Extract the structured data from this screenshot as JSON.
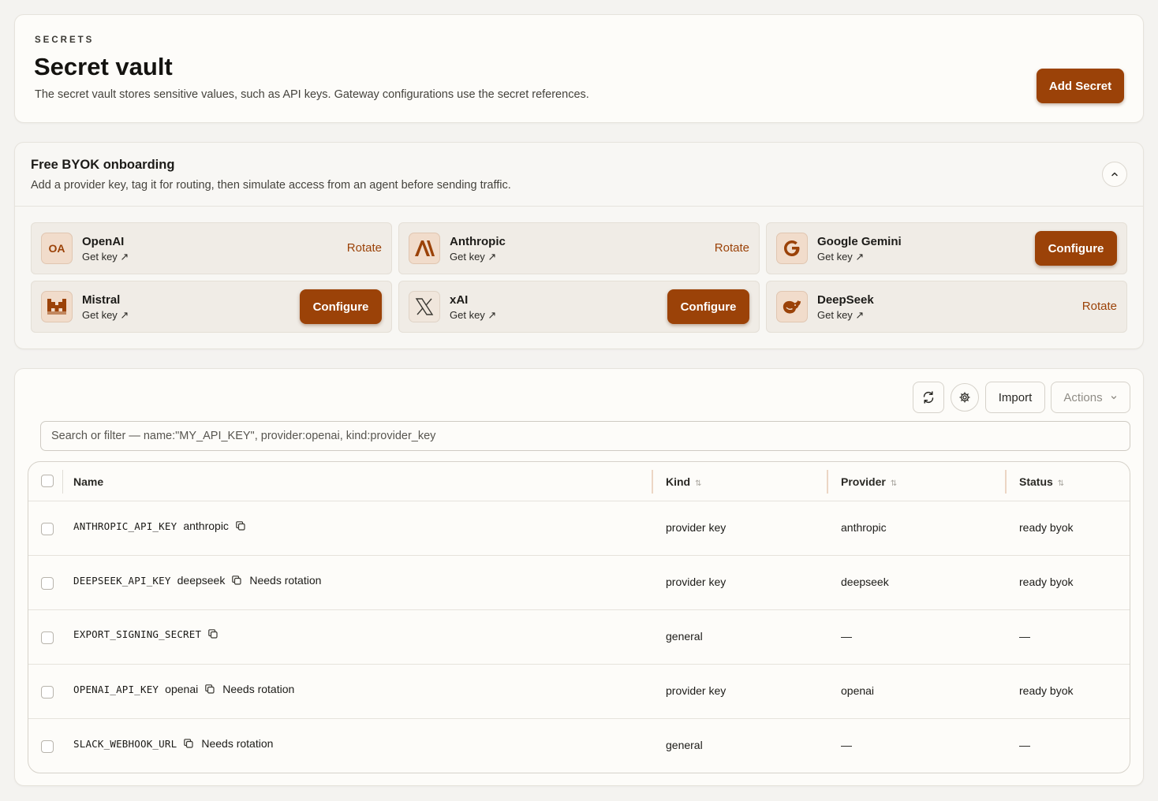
{
  "header": {
    "eyebrow": "SECRETS",
    "title": "Secret vault",
    "description": "The secret vault stores sensitive values, such as API keys. Gateway configurations use the secret references.",
    "add_button": "Add Secret"
  },
  "onboarding": {
    "title": "Free BYOK onboarding",
    "description": "Add a provider key, tag it for routing, then simulate access from an agent before sending traffic.",
    "get_key_label": "Get key ↗",
    "providers": [
      {
        "name": "OpenAI",
        "logo": "OA",
        "icon": "openai-logo",
        "action": "Rotate"
      },
      {
        "name": "Anthropic",
        "logo": "A\\",
        "icon": "anthropic-logo",
        "action": "Rotate"
      },
      {
        "name": "Google Gemini",
        "logo": "G",
        "icon": "google-logo",
        "action": "Configure"
      },
      {
        "name": "Mistral",
        "logo": "",
        "icon": "mistral-logo",
        "action": "Configure"
      },
      {
        "name": "xAI",
        "logo": "",
        "icon": "xai-logo",
        "action": "Configure"
      },
      {
        "name": "DeepSeek",
        "logo": "",
        "icon": "deepseek-logo",
        "action": "Rotate"
      }
    ]
  },
  "toolbar": {
    "import_label": "Import",
    "actions_label": "Actions",
    "search_placeholder": "Search or filter — name:\"MY_API_KEY\", provider:openai, kind:provider_key"
  },
  "table": {
    "columns": [
      "Name",
      "Kind",
      "Provider",
      "Status"
    ],
    "rows": [
      {
        "name": "ANTHROPIC_API_KEY",
        "tag": "anthropic",
        "note": "",
        "kind": "provider key",
        "provider": "anthropic",
        "status": "ready byok"
      },
      {
        "name": "DEEPSEEK_API_KEY",
        "tag": "deepseek",
        "note": "Needs rotation",
        "kind": "provider key",
        "provider": "deepseek",
        "status": "ready byok"
      },
      {
        "name": "EXPORT_SIGNING_SECRET",
        "tag": "",
        "note": "",
        "kind": "general",
        "provider": "—",
        "status": "—"
      },
      {
        "name": "OPENAI_API_KEY",
        "tag": "openai",
        "note": "Needs rotation",
        "kind": "provider key",
        "provider": "openai",
        "status": "ready byok"
      },
      {
        "name": "SLACK_WEBHOOK_URL",
        "tag": "",
        "note": "Needs rotation",
        "kind": "general",
        "provider": "—",
        "status": "—"
      }
    ]
  },
  "colors": {
    "accent": "#9b4208",
    "background": "#f4f3f0",
    "card": "#fdfcf9"
  }
}
